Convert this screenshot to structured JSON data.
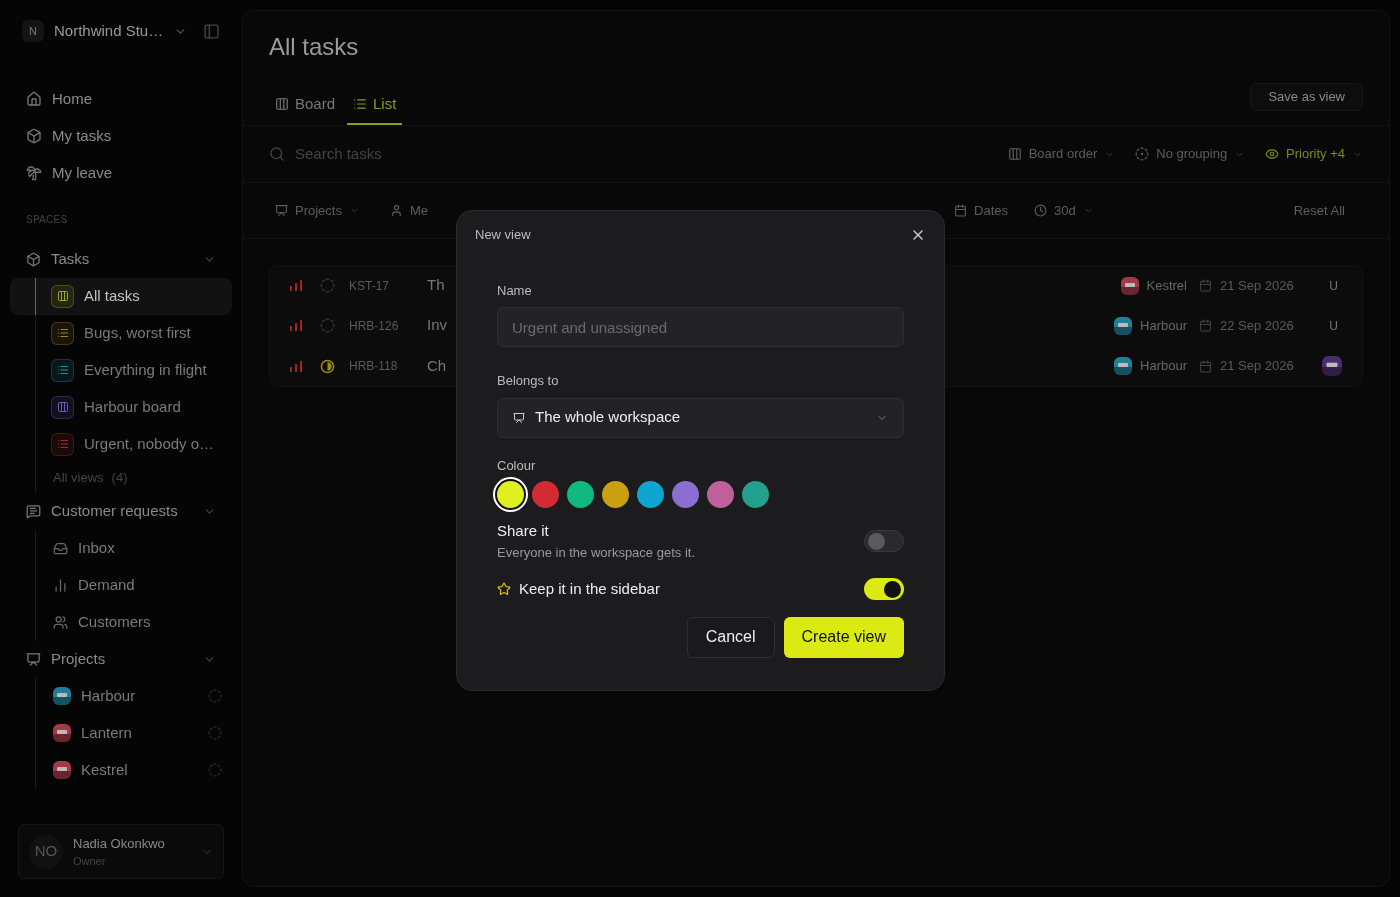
{
  "workspace": {
    "initial": "N",
    "name": "Northwind Stu…"
  },
  "nav": [
    {
      "kind": "home",
      "label": "Home"
    },
    {
      "kind": "tasks",
      "label": "My tasks"
    },
    {
      "kind": "leave",
      "label": "My leave"
    }
  ],
  "spaces_label": "SPACES",
  "spaces": [
    {
      "kind": "tasks",
      "label": "Tasks",
      "expanded": true,
      "views": [
        {
          "kind": "board",
          "label": "All tasks",
          "color": "#9aa81c",
          "selected": true
        },
        {
          "kind": "list",
          "label": "Bugs, worst first",
          "color": "#a6841a",
          "selected": false
        },
        {
          "kind": "list",
          "label": "Everything in flight",
          "color": "#1b8fa6",
          "selected": false
        },
        {
          "kind": "board",
          "label": "Harbour board",
          "color": "#6b5cc4",
          "selected": false
        },
        {
          "kind": "list",
          "label": "Urgent, nobody o…",
          "color": "#b02a2a",
          "selected": false
        }
      ],
      "more": {
        "label": "All views",
        "count": "(4)"
      }
    },
    {
      "kind": "requests",
      "label": "Customer requests",
      "expanded": true,
      "items": [
        {
          "kind": "inbox",
          "label": "Inbox"
        },
        {
          "kind": "demand",
          "label": "Demand"
        },
        {
          "kind": "customers",
          "label": "Customers"
        }
      ]
    },
    {
      "kind": "projects",
      "label": "Projects",
      "expanded": true,
      "projects": [
        {
          "label": "Harbour",
          "color": "#1f7f96"
        },
        {
          "label": "Lantern",
          "color": "#a33a48"
        },
        {
          "label": "Kestrel",
          "color": "#a33a48"
        }
      ]
    }
  ],
  "user": {
    "initials": "NO",
    "name": "Nadia Okonkwo",
    "role": "Owner"
  },
  "page_title": "All tasks",
  "tabs": [
    {
      "kind": "board",
      "label": "Board",
      "selected": false
    },
    {
      "kind": "list",
      "label": "List",
      "selected": true
    }
  ],
  "save_view": "Save as view",
  "search": {
    "placeholder": "Search tasks"
  },
  "sort_controls": [
    {
      "kind": "order",
      "label": "Board order",
      "active": false
    },
    {
      "kind": "group",
      "label": "No grouping",
      "active": false
    },
    {
      "kind": "visible",
      "label": "Priority +4",
      "active": true
    }
  ],
  "filters": [
    {
      "kind": "projects",
      "label": "Projects",
      "dropdown": true
    },
    {
      "kind": "me",
      "label": "Me",
      "dropdown": false
    }
  ],
  "filters_right": [
    {
      "kind": "dates",
      "label": "Dates",
      "dropdown": false
    },
    {
      "kind": "period",
      "label": "30d",
      "dropdown": true
    }
  ],
  "reset": "Reset All",
  "tasks": [
    {
      "kind": "todo",
      "id": "KST-17",
      "title": "Th",
      "project": {
        "label": "Kestrel",
        "color": "#a33a48"
      },
      "date": "21 Sep 2026",
      "assignee": {
        "kind": "initial",
        "text": "U"
      }
    },
    {
      "kind": "todo",
      "id": "HRB-126",
      "title": "Inv",
      "project": {
        "label": "Harbour",
        "color": "#1f7f96"
      },
      "date": "22 Sep 2026",
      "assignee": {
        "kind": "initial",
        "text": "U"
      }
    },
    {
      "kind": "in_progress",
      "id": "HRB-118",
      "title": "Ch",
      "project": {
        "label": "Harbour",
        "color": "#1f7f96"
      },
      "date": "21 Sep 2026",
      "assignee": {
        "kind": "avatar",
        "color": "#4a2f70"
      }
    }
  ],
  "dialog": {
    "title": "New view",
    "name": {
      "label": "Name",
      "placeholder": "Urgent and unassigned"
    },
    "belongs": {
      "label": "Belongs to",
      "value": "The whole workspace"
    },
    "colour": {
      "label": "Colour",
      "swatches": [
        {
          "color": "#e0f01e",
          "selected": true
        },
        {
          "color": "#d42a34",
          "selected": false
        },
        {
          "color": "#10b981",
          "selected": false
        },
        {
          "color": "#c9a010",
          "selected": false
        },
        {
          "color": "#0ea5d0",
          "selected": false
        },
        {
          "color": "#8b6fd0",
          "selected": false
        },
        {
          "color": "#c0609a",
          "selected": false
        },
        {
          "color": "#23a08e",
          "selected": false
        }
      ]
    },
    "share": {
      "label": "Share it",
      "description": "Everyone in the workspace gets it.",
      "on": false
    },
    "sidebar": {
      "label": "Keep it in the sidebar",
      "on": true
    },
    "cancel": "Cancel",
    "create": "Create view"
  }
}
